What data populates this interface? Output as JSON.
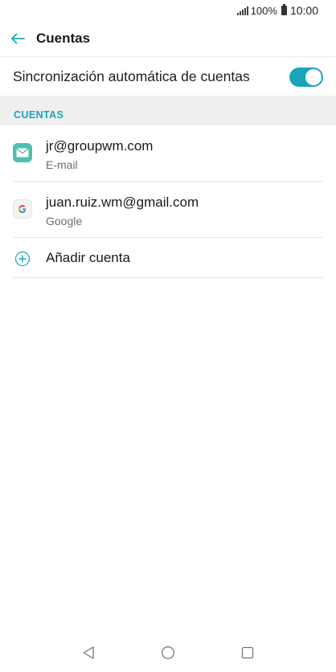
{
  "status_bar": {
    "battery_percent": "100%",
    "time": "10:00"
  },
  "header": {
    "title": "Cuentas"
  },
  "sync": {
    "label": "Sincronización automática de cuentas",
    "enabled": true
  },
  "section": {
    "title": "CUENTAS"
  },
  "accounts": [
    {
      "name": "jr@groupwm.com",
      "type": "E-mail",
      "icon": "email-icon"
    },
    {
      "name": "juan.ruiz.wm@gmail.com",
      "type": "Google",
      "icon": "google-icon"
    }
  ],
  "add_account": {
    "label": "Añadir cuenta",
    "icon": "plus-circle-icon"
  },
  "colors": {
    "accent": "#1aa4b8",
    "section_bg": "#efefef"
  }
}
